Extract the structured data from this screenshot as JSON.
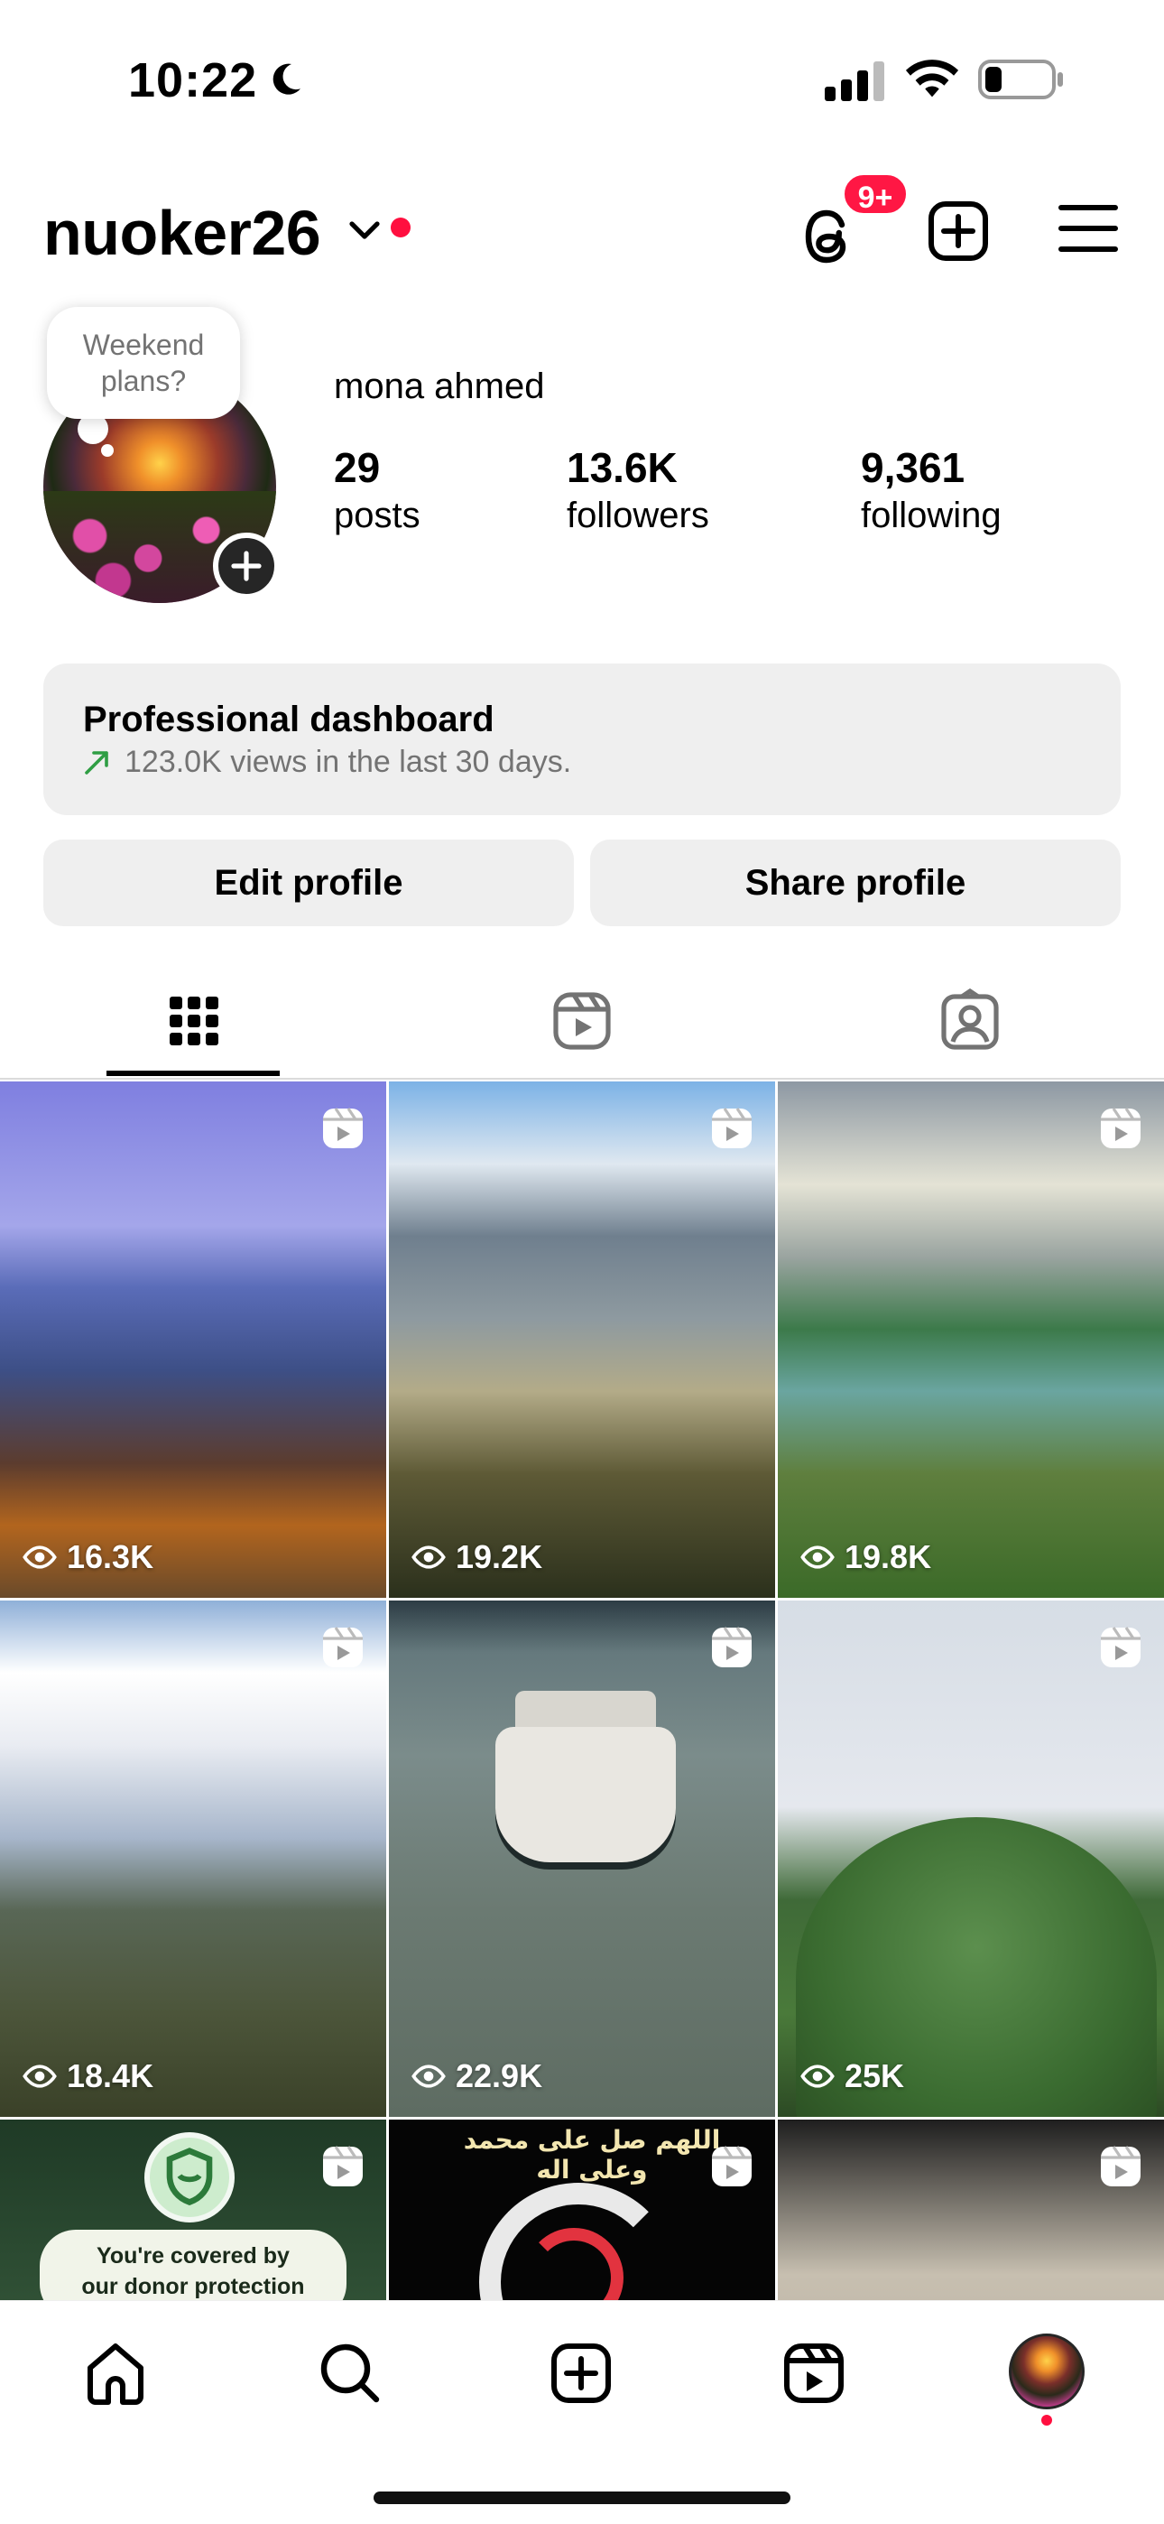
{
  "status_bar": {
    "time": "10:22"
  },
  "header": {
    "username": "nuoker26",
    "notification_badge": "9+"
  },
  "profile": {
    "note": "Weekend\nplans?",
    "display_name": "mona ahmed",
    "stats": [
      {
        "value": "29",
        "label": "posts"
      },
      {
        "value": "13.6K",
        "label": "followers"
      },
      {
        "value": "9,361",
        "label": "following"
      }
    ]
  },
  "dashboard": {
    "title": "Professional dashboard",
    "subtitle": "123.0K views in the last 30 days."
  },
  "actions": {
    "edit_label": "Edit profile",
    "share_label": "Share profile"
  },
  "tabs": [
    {
      "icon": "grid-icon",
      "active": true
    },
    {
      "icon": "reels-icon",
      "active": false
    },
    {
      "icon": "tagged-icon",
      "active": false
    }
  ],
  "grid": [
    {
      "views": "16.3K",
      "type": "reel"
    },
    {
      "views": "19.2K",
      "type": "reel"
    },
    {
      "views": "19.8K",
      "type": "reel"
    },
    {
      "views": "18.4K",
      "type": "reel"
    },
    {
      "views": "22.9K",
      "type": "reel"
    },
    {
      "views": "25K",
      "type": "reel"
    },
    {
      "views": "",
      "type": "reel",
      "overlay_text": "You're covered by\nour donor protection"
    },
    {
      "views": "",
      "type": "reel",
      "overlay_text": "اللهم صل على محمد وعلى اله"
    },
    {
      "views": "",
      "type": "reel"
    }
  ],
  "bottom_nav": [
    {
      "icon": "home-icon"
    },
    {
      "icon": "search-icon"
    },
    {
      "icon": "create-icon"
    },
    {
      "icon": "reels-icon"
    },
    {
      "icon": "profile-avatar"
    }
  ],
  "colors": {
    "accent_red": "#ff0f3f",
    "button_bg": "#efefef",
    "muted_text": "#737373"
  }
}
